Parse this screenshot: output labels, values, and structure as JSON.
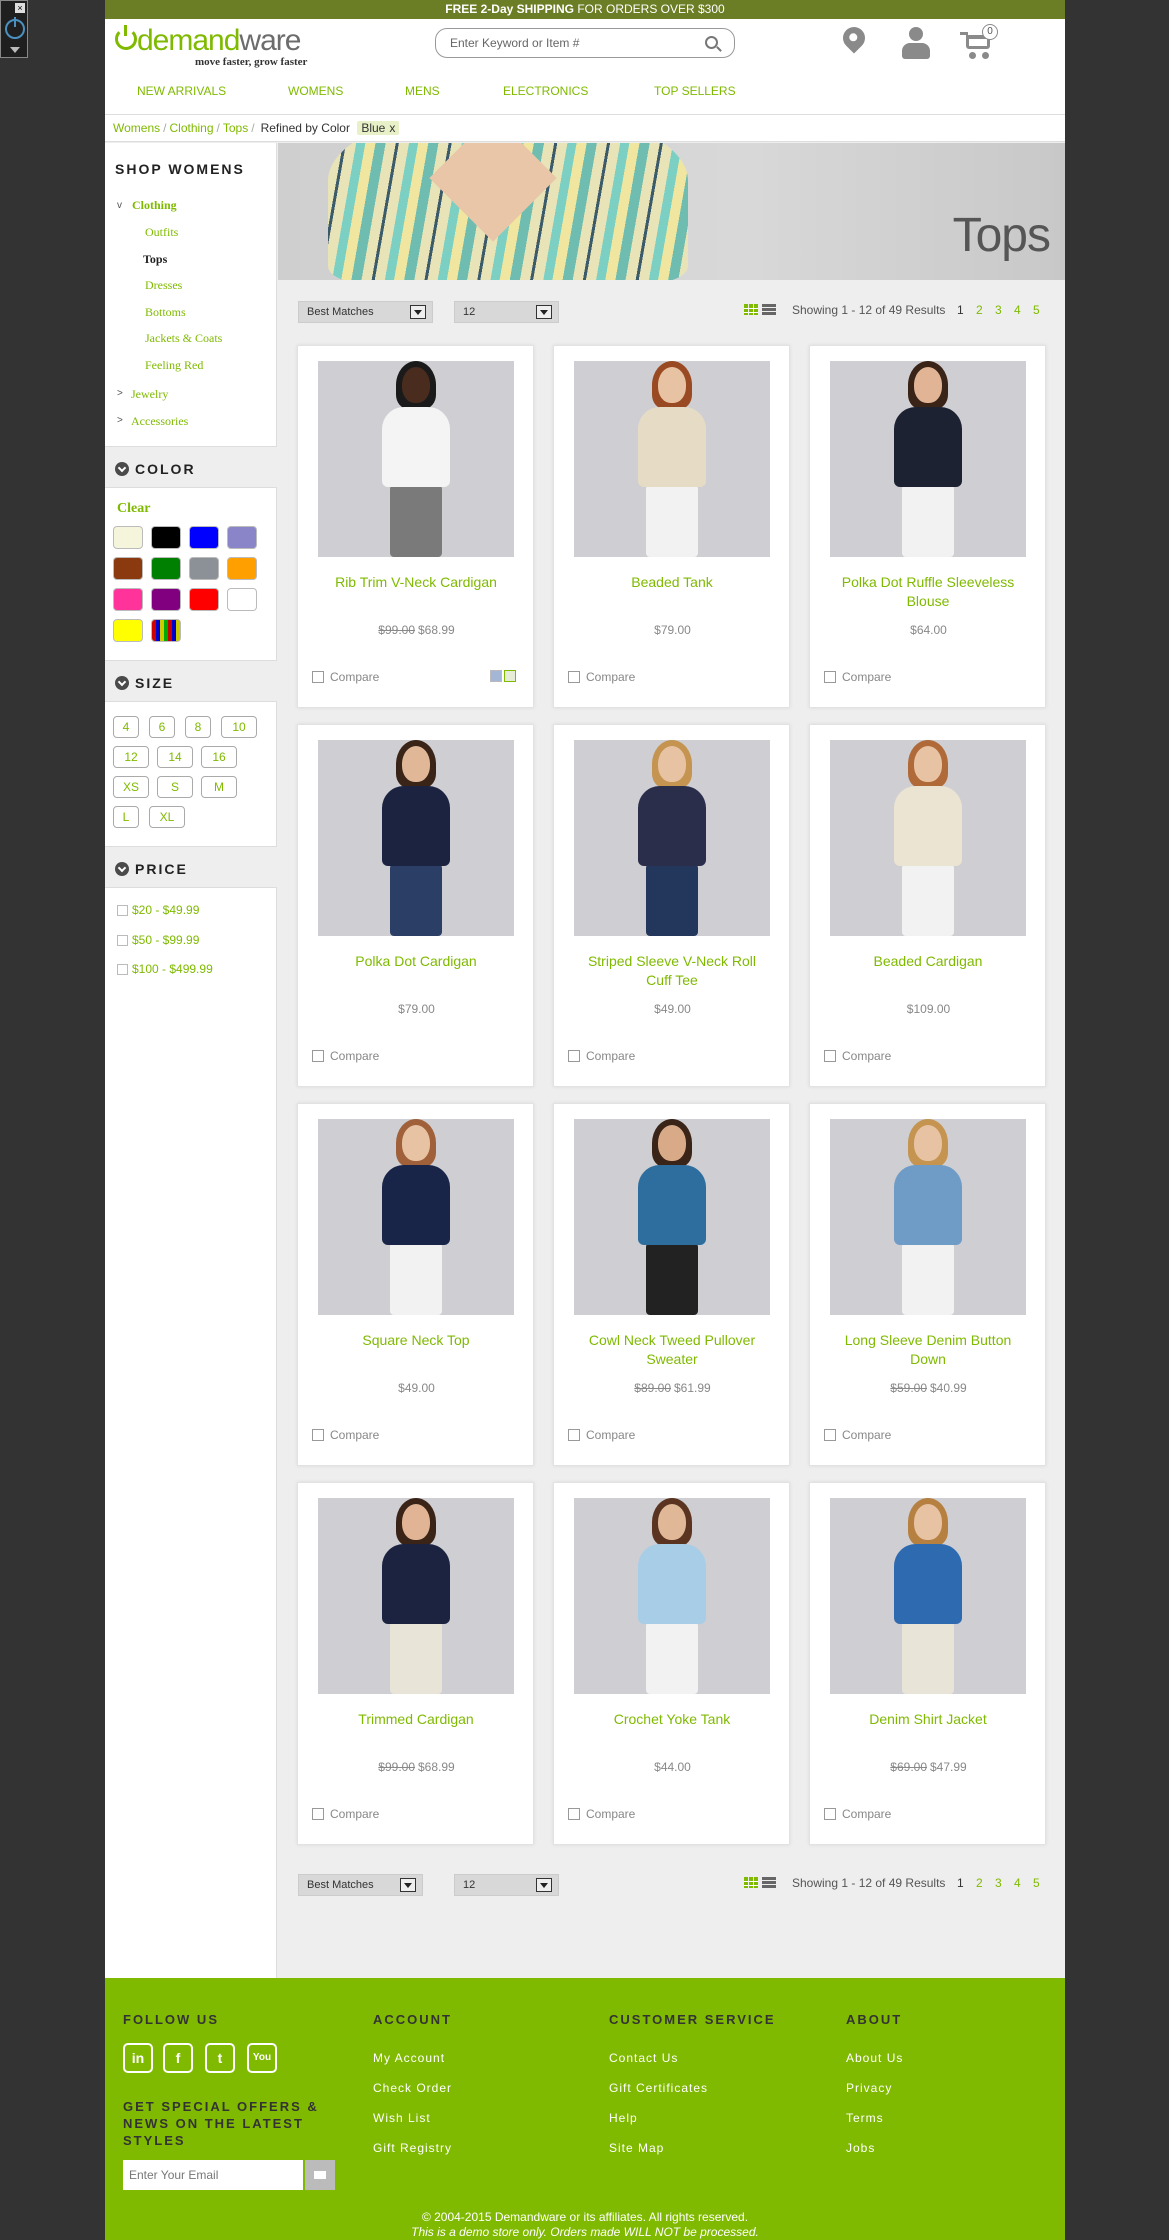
{
  "promo": {
    "bold": "FREE 2-Day SHIPPING",
    "rest": " FOR ORDERS OVER $300"
  },
  "logo": {
    "word_green": "demand",
    "word_gray": "ware",
    "tagline": "move faster, grow faster"
  },
  "search": {
    "placeholder": "Enter Keyword or Item #"
  },
  "cart": {
    "count": "0"
  },
  "nav": [
    "NEW ARRIVALS",
    "WOMENS",
    "MENS",
    "ELECTRONICS",
    "TOP SELLERS"
  ],
  "breadcrumb": {
    "items": [
      "Womens",
      "Clothing",
      "Tops"
    ],
    "refined_label": "Refined by",
    "refine_attr": "Color",
    "refine_value": "Blue",
    "remove": "x"
  },
  "sidebar": {
    "heading": "SHOP WOMENS",
    "clothing": "Clothing",
    "clothing_children": [
      "Outfits",
      "Tops",
      "Dresses",
      "Bottoms",
      "Jackets & Coats",
      "Feeling Red"
    ],
    "active": "Tops",
    "jewelry": "Jewelry",
    "accessories": "Accessories",
    "color_heading": "COLOR",
    "clear": "Clear",
    "colors": [
      "#f5f5dc",
      "#000000",
      "#0000ff",
      "#8a84c8",
      "#8b3a0f",
      "#008000",
      "#8c9097",
      "#ffa000",
      "#ff3399",
      "#800080",
      "#ff0000",
      "#ffffff",
      "#ffff00",
      "multi"
    ],
    "size_heading": "SIZE",
    "sizes": [
      "4",
      "6",
      "8",
      "10",
      "12",
      "14",
      "16",
      "XS",
      "S",
      "M",
      "L",
      "XL"
    ],
    "price_heading": "PRICE",
    "prices": [
      "$20 - $49.99",
      "$50 - $99.99",
      "$100 - $499.99"
    ]
  },
  "banner": {
    "title": "Tops"
  },
  "toolbar": {
    "sort": "Best Matches",
    "per_page": "12",
    "showing": "Showing 1 - 12 of 49 Results",
    "pages": [
      "1",
      "2",
      "3",
      "4",
      "5"
    ]
  },
  "products": [
    {
      "name": "Rib Trim V-Neck Cardigan",
      "old": "$99.00",
      "price": "$68.99",
      "top": "#f4f4f4",
      "bottom": "#7a7a7a",
      "skin": "#4a2c1e",
      "hair": "#1a1a1a",
      "swatches": true
    },
    {
      "name": "Beaded Tank",
      "old": "",
      "price": "$79.00",
      "top": "#e6dcc6",
      "bottom": "#f2f2f2",
      "skin": "#e7c3a4",
      "hair": "#9a4a22"
    },
    {
      "name": "Polka Dot Ruffle Sleeveless Blouse",
      "old": "",
      "price": "$64.00",
      "top": "#1d2233",
      "bottom": "#f2f2f2",
      "skin": "#e0b494",
      "hair": "#3a2418"
    },
    {
      "name": "Polka Dot Cardigan",
      "old": "",
      "price": "$79.00",
      "top": "#1b2340",
      "bottom": "#2b3f66",
      "skin": "#e0b898",
      "hair": "#3a2418"
    },
    {
      "name": "Striped Sleeve V-Neck Roll Cuff Tee",
      "old": "",
      "price": "$49.00",
      "top": "#2a2e4a",
      "bottom": "#23375c",
      "skin": "#e7c3a4",
      "hair": "#c49450"
    },
    {
      "name": "Beaded Cardigan",
      "old": "",
      "price": "$109.00",
      "top": "#ece4d2",
      "bottom": "#f2f2f2",
      "skin": "#e7c3a4",
      "hair": "#b06a3a"
    },
    {
      "name": "Square Neck Top",
      "old": "",
      "price": "$49.00",
      "top": "#182548",
      "bottom": "#f2f2f2",
      "skin": "#e7c3a4",
      "hair": "#a0603a"
    },
    {
      "name": "Cowl Neck Tweed Pullover Sweater",
      "old": "$89.00",
      "price": "$61.99",
      "top": "#2e6e9e",
      "bottom": "#222222",
      "skin": "#d8aa88",
      "hair": "#3a2418"
    },
    {
      "name": "Long Sleeve Denim Button Down",
      "old": "$59.00",
      "price": "$40.99",
      "top": "#6f9cc6",
      "bottom": "#f2f2f2",
      "skin": "#e7c3a4",
      "hair": "#c49450"
    },
    {
      "name": "Trimmed Cardigan",
      "old": "$99.00",
      "price": "$68.99",
      "top": "#1b2340",
      "bottom": "#e9e4d8",
      "skin": "#e0b494",
      "hair": "#3a2418"
    },
    {
      "name": "Crochet Yoke Tank",
      "old": "",
      "price": "$44.00",
      "top": "#a8cde6",
      "bottom": "#f2f2f2",
      "skin": "#e0b898",
      "hair": "#5a3420"
    },
    {
      "name": "Denim Shirt Jacket",
      "old": "$69.00",
      "price": "$47.99",
      "top": "#2e6ab0",
      "bottom": "#e9e4d8",
      "skin": "#e7c3a4",
      "hair": "#b68040"
    }
  ],
  "compare_label": "Compare",
  "footer": {
    "follow": "FOLLOW US",
    "social": [
      "in",
      "f",
      "t",
      "You"
    ],
    "offers": "GET SPECIAL OFFERS & NEWS ON THE LATEST STYLES",
    "email_placeholder": "Enter Your Email",
    "account": {
      "heading": "ACCOUNT",
      "links": [
        "My Account",
        "Check Order",
        "Wish List",
        "Gift Registry"
      ]
    },
    "service": {
      "heading": "CUSTOMER SERVICE",
      "links": [
        "Contact Us",
        "Gift Certificates",
        "Help",
        "Site Map"
      ]
    },
    "about": {
      "heading": "ABOUT",
      "links": [
        "About Us",
        "Privacy",
        "Terms",
        "Jobs"
      ]
    },
    "copyright": "© 2004-2015 Demandware or its affiliates. All rights reserved.",
    "demo": "This is a demo store only. Orders made WILL NOT be processed."
  },
  "colors": {
    "accent": "#7fba00",
    "promo_bar": "#6b7d25",
    "background": "#333333"
  }
}
